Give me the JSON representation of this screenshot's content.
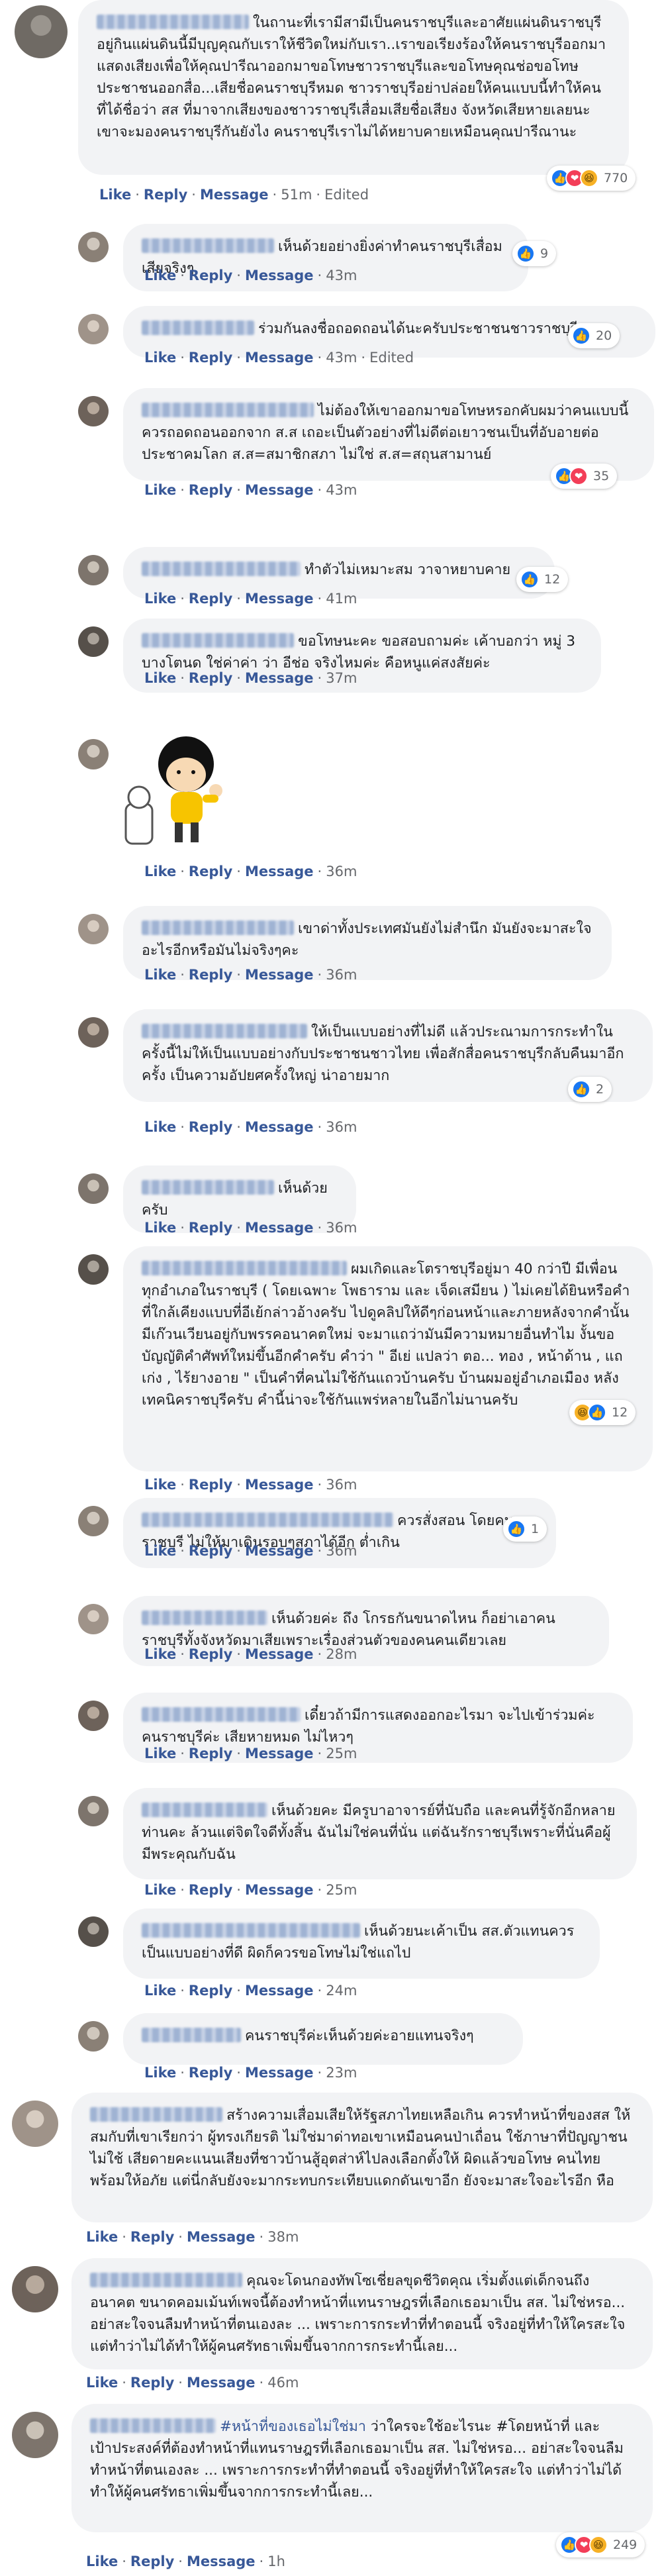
{
  "actions": {
    "like": "Like",
    "reply": "Reply",
    "message": "Message",
    "edited": "Edited",
    "dot": "·"
  },
  "colors": {
    "bubble": "#f2f3f5",
    "link": "#385898",
    "meta": "#65676b",
    "like": "#1877f2",
    "love": "#f33e58",
    "haha": "#f7b125"
  },
  "comments": [
    {
      "text": "ในถานะที่เรามีสามีเป็นคนราชบุรีและอาศัยแผ่นดินราชบุรีอยู่กินแผ่นดินนี้มีบุญคุณกับเราให้ชีวิตใหม่กับเรา..เราขอเรียงร้องให้คนราชบุรีออกมาแสดงเสียงเพื่อให้คุณปารีณาออกมาขอโทษชาวราชบุรีและขอโทษคุณช่อขอโทษประชาชนออกสื่อ...เสียชื่อคนราชบุรีหมด ชาวราชบุรีอย่าปล่อยให้คนแบบนี้ทำให้คนที่ได้ชื่อว่า สส ที่มาจากเสียงของชาวราชบุรีเสื่อมเสียชื่อเสียง จังหวัดเสียหายเลยนะเขาจะมองคนราชบุรีกันยังไง คนราชบุรีเราไม่ได้หยาบคายเหมือนคุณปารีณานะ",
      "time": "51m",
      "edited": true,
      "reactions": [
        "like",
        "love",
        "haha"
      ],
      "count": "770"
    },
    {
      "text": "เห็นด้วยอย่างยิ่งค่าทำคนราชบุรีเสื่อมเสียจริงๆ",
      "time": "43m",
      "edited": false,
      "reactions": [
        "like"
      ],
      "count": "9"
    },
    {
      "text": "ร่วมกันลงชื่อถอดถอนได้นะครับประชาชนชาวราชบุรี",
      "time": "43m",
      "edited": true,
      "reactions": [
        "like"
      ],
      "count": "20"
    },
    {
      "text": "ไม่ต้องให้เขาออกมาขอโทษหรอกคับผมว่าคนแบบนี้ควรถอดถอนออกจาก ส.ส เถอะเป็นตัวอย่างที่ไม่ดีต่อเยาวชนเป็นที่อับอายต่อประชาคมโลก ส.ส=สมาชิกสภา ไม่ใช่ ส.ส=สถุนสามานย์",
      "time": "43m",
      "edited": false,
      "reactions": [
        "like",
        "love"
      ],
      "count": "35"
    },
    {
      "text": "ทำตัวไม่เหมาะสม วาจาหยาบคาย",
      "time": "41m",
      "edited": false,
      "reactions": [
        "like"
      ],
      "count": "12"
    },
    {
      "text": "ขอโทษนะคะ ขอสอบถามค่ะ เค้าบอกว่า หมู่ 3 บางโตนด ใช่ค่าค่า ว่า อีช่อ จริงไหมค่ะ คือหนูแค่สงสัยค่ะ",
      "time": "37m",
      "edited": false,
      "reactions": [],
      "count": ""
    },
    {
      "text": "",
      "time": "36m",
      "edited": false,
      "reactions": [],
      "count": ""
    },
    {
      "text": "เขาด่าทั้งประเทศมันยังไม่สำนึก มันยังจะมาสะใจอะไรอีกหรือมันไม่จริงๆคะ",
      "time": "36m",
      "edited": false,
      "reactions": [],
      "count": ""
    },
    {
      "text": "ให้เป็นแบบอย่างที่ไม่ดี แล้วประณามการกระทำในครั้งนี้ไม่ให้เป็นแบบอย่างกับประชาชนชาวไทย เพื่อสักสื่อคนราชบุรีกลับคืนมาอีกครั้ง เป็นความอัปยศครั้งใหญ่ น่าอายมาก",
      "time": "36m",
      "edited": false,
      "reactions": [
        "like"
      ],
      "count": "2"
    },
    {
      "text": "เห็นด้วยครับ",
      "time": "36m",
      "edited": false,
      "reactions": [],
      "count": ""
    },
    {
      "text": "ผมเกิดและโตราชบุรีอยู่มา 40 กว่าปี มีเพื่อนทุกอำเภอในราชบุรี ( โดยเฉพาะ โพธาราม และ เจ็ดเสมียน ) ไม่เคยได้ยินหรือคำที่ใกล้เคียงแบบที่อีเย้กล่าวอ้างครับ ไปดูคลิปให้ดีๆก่อนหน้าและภายหลังจากคำนั้น มีเก๊วนเวียนอยู่กับพรรคอนาคตใหม่ จะมาแถว่ามันมีความหมายอื่นทำไม งั้นขอบัญญัติคำศัพท์ใหม่ขึ้นอีกคำครับ คำว่า \" อีเย่ แปลว่า ตอ... ทอง , หน้าด้าน , แถเก่ง , ไร้ยางอาย \" เป็นคำที่คนไม่ใช้กันแถวบ้านครับ บ้านผมอยู่อำเภอเมือง หลังเทคนิคราชบุรีครับ คำนี้น่าจะใช้กันแพร่หลายในอีกไม่นานครับ",
      "time": "36m",
      "edited": false,
      "reactions": [
        "haha",
        "like"
      ],
      "count": "12"
    },
    {
      "text": "ควรสั่งสอน โดยคนราชบุรี ไม่ให้มาเดินรอบๆสภาได้อีก ต่ำเกิน",
      "time": "36m",
      "edited": false,
      "reactions": [
        "like"
      ],
      "count": "1"
    },
    {
      "text": "เห็นด้วยค่ะ ถึง โกรธกันขนาดไหน ก็อย่าเอาคนราชบุรีทั้งจังหวัดมาเสียเพราะเรื่องส่วนตัวของคนคนเดียวเลย",
      "time": "28m",
      "edited": false,
      "reactions": [],
      "count": ""
    },
    {
      "text": "เดี๋ยวถ้ามีการแสดงออกอะไรมา จะไปเข้าร่วมค่ะ คนราชบุรีค่ะ เสียหายหมด ไม่ไหวๆ",
      "time": "25m",
      "edited": false,
      "reactions": [],
      "count": ""
    },
    {
      "text": "เห็นด้วยคะ มีครูบาอาจารย์ที่นับถือ และคนที่รู้จักอีกหลายท่านคะ ล้วนแต่จิตใจดีทั้งสิ้น ฉันไม่ใช่คนที่นั่น แต่ฉันรักราชบุรีเพราะที่นั่นคือผู้มีพระคุณกับฉัน",
      "time": "25m",
      "edited": false,
      "reactions": [],
      "count": ""
    },
    {
      "text": "เห็นด้วยนะเค้าเป็น สส.ตัวแทนควรเป็นแบบอย่างที่ดี ผิดก็ควรขอโทษไม่ใช่แถไป",
      "time": "24m",
      "edited": false,
      "reactions": [],
      "count": ""
    },
    {
      "text": "คนราชบุรีค่ะเห็นด้วยค่ะอายแทนจริงๆ",
      "time": "23m",
      "edited": false,
      "reactions": [],
      "count": ""
    },
    {
      "text": "สร้างความเสื่อมเสียให้รัฐสภาไทยเหลือเกิน ควรทำหน้าที่ของสส ให้สมกับที่เขาเรียกว่า ผู้ทรงเกียรติ ไม่ใช่มาด่าทอเขาเหมือนคนป่าเถื่อน ใช้ภาษาที่ปัญญาชนไม่ใช้ เสียดายคะแนนเสียงที่ชาวบ้านสู้อุตส่าห์ไปลงเลือกตั้งให้ ผิดแล้วขอโทษ คนไทยพร้อมให้อภัย แต่นี่กลับยังจะมากระทบกระเทียบแดกดันเขาอีก ยังจะมาสะใจอะไรอีก หือ",
      "time": "38m",
      "edited": false,
      "reactions": [],
      "count": ""
    },
    {
      "text": "คุณจะโดนกองทัพโซเชี่ยลขุดชีวิตคุณ เริ่มตั้งแต่เด็กจนถึงอนาคต ขนาดคอมเม้นท์เพจนี้ต้องทำหน้าที่แทนราษฎรที่เลือกเธอมาเป็น สส. ไม่ใช่หรอ... อย่าสะใจจนลืมทำหน้าที่ตนเองละ ... เพราะการกระทำที่ทำตอนนี้ จริงอยู่ที่ทำให้ใครสะใจ แต่ทำว่าไม่ได้ทำให้ผู้คนศรัทธาเพิ่มขึ้นจากการกระทำนี้เลย...",
      "time": "46m",
      "edited": false,
      "reactions": [],
      "count": ""
    },
    {
      "hashtag": "#หน้าที่ของเธอไม่ใช่มา",
      "text": "ว่าใครจะใช้อะไรนะ #โดยหน้าที่ และเป้าประสงค์ที่ต้องทำหน้าที่แทนราษฎรที่เลือกเธอมาเป็น สส. ไม่ใช่หรอ... อย่าสะใจจนลืมทำหน้าที่ตนเองละ ... เพราะการกระทำที่ทำตอนนี้ จริงอยู่ที่ทำให้ใครสะใจ แต่ทำว่าไม่ได้ทำให้ผู้คนศรัทธาเพิ่มขึ้นจากการกระทำนี้เลย...",
      "time": "1h",
      "edited": false,
      "reactions": [
        "like",
        "love",
        "haha"
      ],
      "count": "249"
    }
  ]
}
